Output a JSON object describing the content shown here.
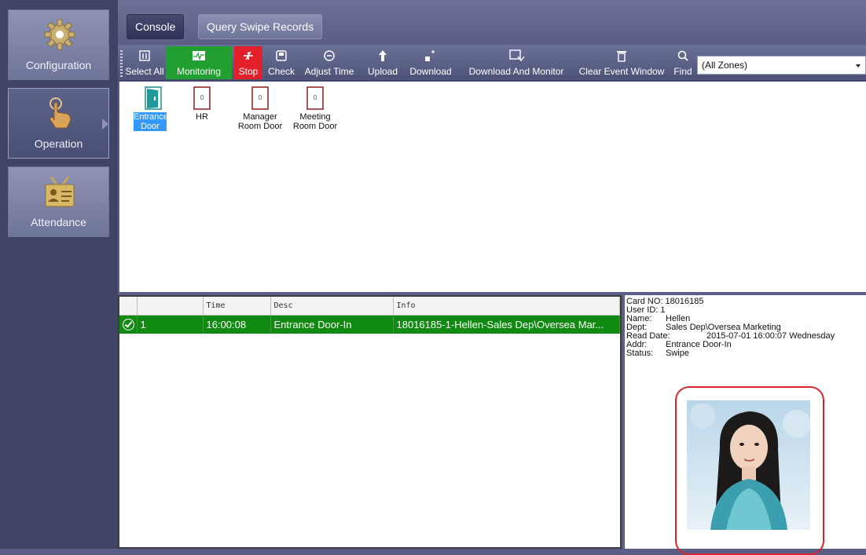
{
  "sidebar": {
    "items": [
      {
        "label": "Configuration",
        "icon": "gear-icon"
      },
      {
        "label": "Operation",
        "icon": "hand-pointer-icon"
      },
      {
        "label": "Attendance",
        "icon": "id-badge-icon"
      }
    ],
    "active": "Operation"
  },
  "tabs": [
    {
      "label": "Console"
    },
    {
      "label": "Query Swipe Records"
    }
  ],
  "toolbar": {
    "buttons": [
      {
        "label": "Select All",
        "icon": "select-all-icon"
      },
      {
        "label": "Monitoring",
        "icon": "monitor-wave-icon",
        "color": "#21a031"
      },
      {
        "label": "Stop",
        "icon": "stop-icon",
        "color": "#e3202a"
      },
      {
        "label": "Check",
        "icon": "check-icon"
      },
      {
        "label": "Adjust Time",
        "icon": "clock-icon"
      },
      {
        "label": "Upload",
        "icon": "upload-arrow-icon"
      },
      {
        "label": "Download",
        "icon": "download-icon"
      },
      {
        "label": "Download And Monitor",
        "icon": "download-monitor-icon"
      },
      {
        "label": "Clear Event Window",
        "icon": "trash-icon"
      },
      {
        "label": "Find",
        "icon": "search-icon"
      }
    ],
    "zone_select": "(All Zones)"
  },
  "doors": [
    {
      "label_line1": "Entrance",
      "label_line2": "Door",
      "icon": "door-open-icon",
      "badge": "",
      "selected": true
    },
    {
      "label_line1": "HR",
      "label_line2": "",
      "icon": "door-closed-icon",
      "badge": "0",
      "selected": false
    },
    {
      "label_line1": "Manager",
      "label_line2": "Room  Door",
      "icon": "door-closed-icon",
      "badge": "0",
      "selected": false
    },
    {
      "label_line1": "Meeting",
      "label_line2": "Room Door",
      "icon": "door-closed-icon",
      "badge": "0",
      "selected": false
    }
  ],
  "events": {
    "columns": [
      "",
      "",
      "Time",
      "Desc",
      "Info"
    ],
    "rows": [
      {
        "status_icon": "check-circle-icon",
        "index": "1",
        "time": "16:00:08",
        "desc": "Entrance Door-In",
        "info": "18016185-1-Hellen-Sales Dep\\Oversea Mar..."
      }
    ]
  },
  "details": {
    "card_no_label": "Card NO:",
    "card_no": "18016185",
    "user_id_label": "User ID:",
    "user_id": "1",
    "name_label": "Name:",
    "name": "Hellen",
    "dept_label": "Dept:",
    "dept": "Sales Dep\\Oversea Marketing",
    "read_date_label": "Read Date:",
    "read_date": "2015-07-01 16:00:07 Wednesday",
    "addr_label": "Addr:",
    "addr": "Entrance Door-In",
    "status_label": "Status:",
    "status": "Swipe"
  },
  "colors": {
    "accent_green": "#108a10",
    "stop_red": "#e3202a",
    "selection_blue": "#3399ff",
    "photo_frame": "#d8252a"
  }
}
